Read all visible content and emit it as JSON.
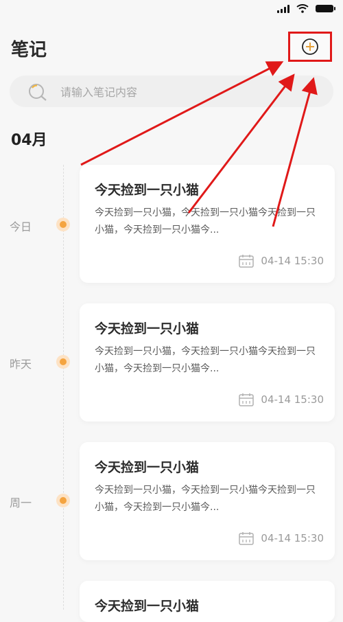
{
  "header": {
    "title": "笔记",
    "add_icon": "plus-circle-icon",
    "accent": "#e6a13a"
  },
  "search": {
    "placeholder": "请输入笔记内容",
    "icon": "search-icon"
  },
  "month": "04月",
  "notes": [
    {
      "day": "今日",
      "title": "今天捡到一只小猫",
      "excerpt": "今天捡到一只小猫，今天捡到一只小猫今天捡到一只小猫，今天捡到一只小猫今...",
      "date": "04-14 15:30"
    },
    {
      "day": "昨天",
      "title": "今天捡到一只小猫",
      "excerpt": "今天捡到一只小猫，今天捡到一只小猫今天捡到一只小猫，今天捡到一只小猫今...",
      "date": "04-14 15:30"
    },
    {
      "day": "周一",
      "title": "今天捡到一只小猫",
      "excerpt": "今天捡到一只小猫，今天捡到一只小猫今天捡到一只小猫，今天捡到一只小猫今...",
      "date": "04-14 15:30"
    },
    {
      "day": "",
      "title": "今天捡到一只小猫",
      "excerpt": "",
      "date": ""
    }
  ],
  "colors": {
    "highlight": "#e01919",
    "dot": "#f4a440",
    "dot_ring": "#fde2c4"
  }
}
